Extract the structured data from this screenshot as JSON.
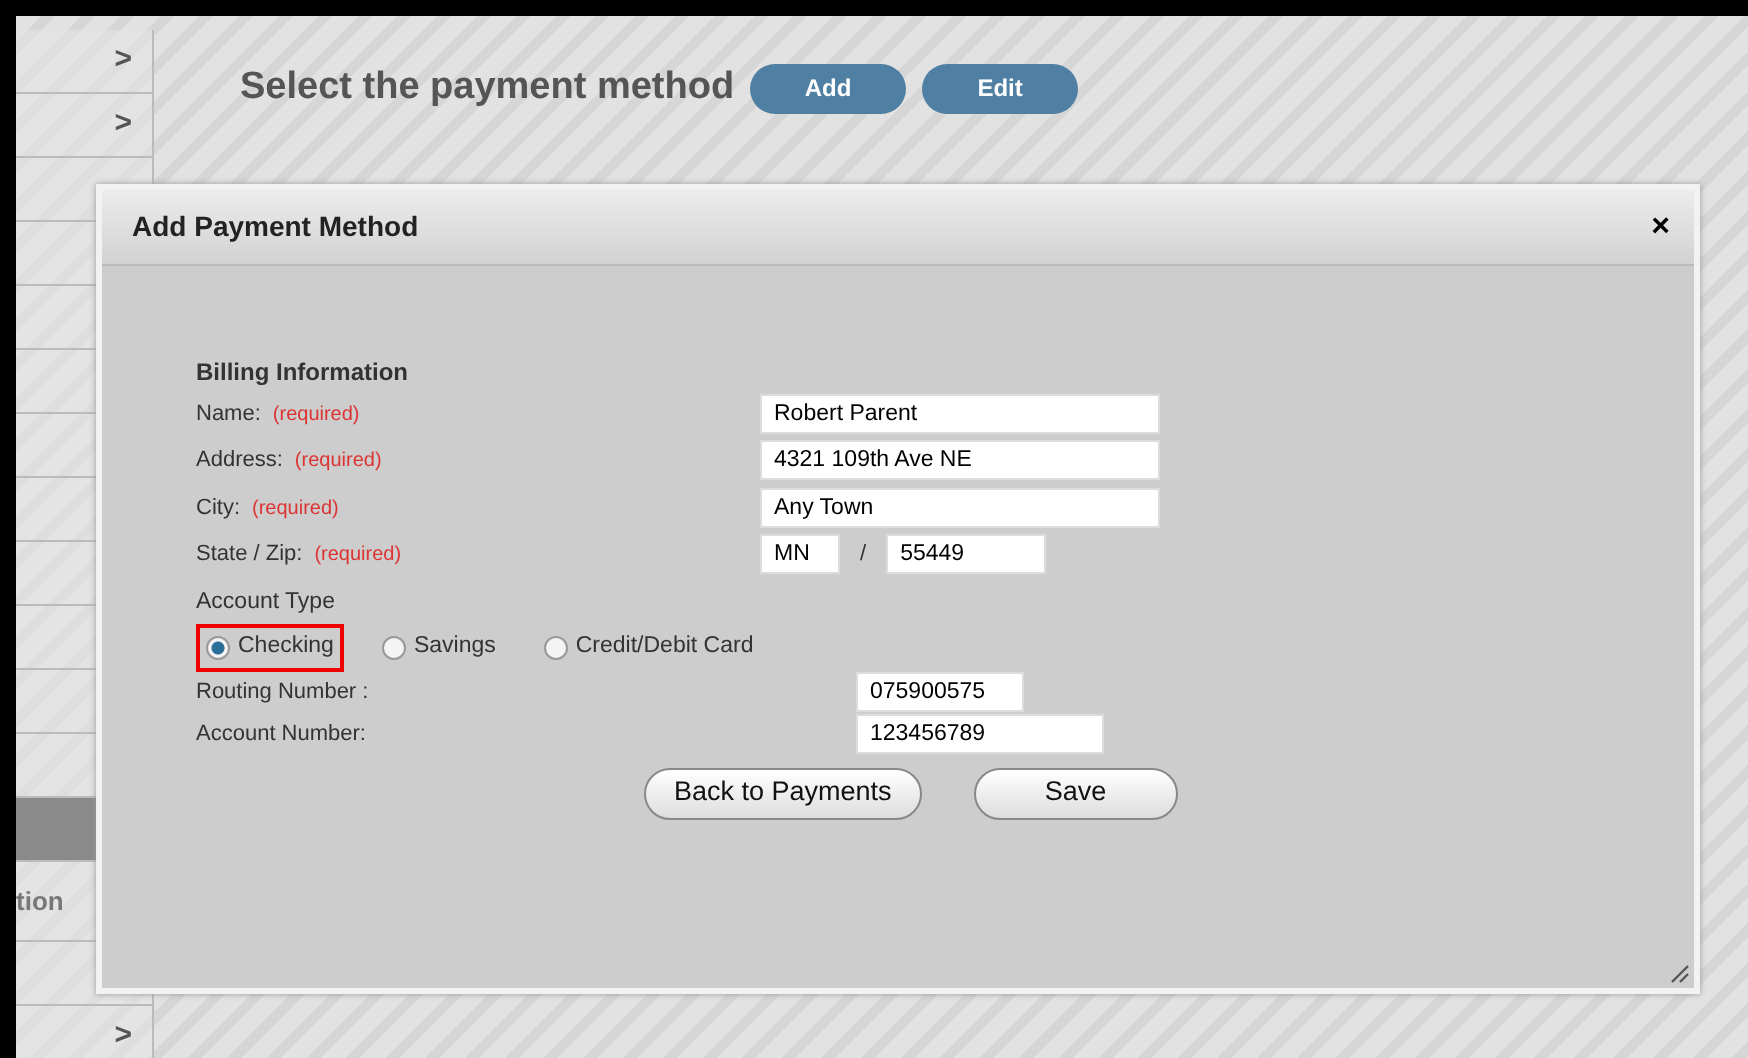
{
  "sidebar": {
    "items": [
      {
        "label": ">",
        "selected": false
      },
      {
        "label": ">",
        "selected": false
      },
      {
        "selected": false
      },
      {
        "selected": false
      },
      {
        "selected": false
      },
      {
        "selected": false
      },
      {
        "selected": false
      },
      {
        "selected": false
      },
      {
        "selected": false
      },
      {
        "selected": false
      },
      {
        "selected": false
      },
      {
        "selected": false
      },
      {
        "selected": true
      },
      {
        "label": "tion",
        "selected": false
      },
      {
        "selected": false
      },
      {
        "label": ">",
        "selected": false
      }
    ]
  },
  "header": {
    "title": "Select the payment method",
    "buttons": [
      "Add",
      "Edit"
    ]
  },
  "dialog": {
    "title": "Add Payment Method",
    "close": "×",
    "section": "Billing Information",
    "fields": [
      {
        "label": "Name:",
        "note": "(required)",
        "values": [
          "Robert Parent"
        ]
      },
      {
        "label": "Address:",
        "note": "(required)",
        "values": [
          "4321 109th Ave NE"
        ]
      },
      {
        "label": "City:",
        "note": "(required)",
        "values": [
          "Any Town"
        ]
      },
      {
        "label": "State / Zip:",
        "note": "(required)",
        "values": [
          "MN",
          "55449"
        ],
        "separator": "/"
      }
    ],
    "account_type": {
      "label": "Account Type",
      "options": [
        {
          "label": "Checking",
          "selected": true,
          "highlighted": true
        },
        {
          "label": "Savings",
          "selected": false,
          "highlighted": false
        },
        {
          "label": "Credit/Debit Card",
          "selected": false,
          "highlighted": false
        }
      ]
    },
    "account_fields": [
      {
        "label": "Routing Number :",
        "value": "075900575"
      },
      {
        "label": "Account Number:",
        "value": "123456789"
      }
    ],
    "buttons": [
      "Back to Payments",
      "Save"
    ]
  }
}
